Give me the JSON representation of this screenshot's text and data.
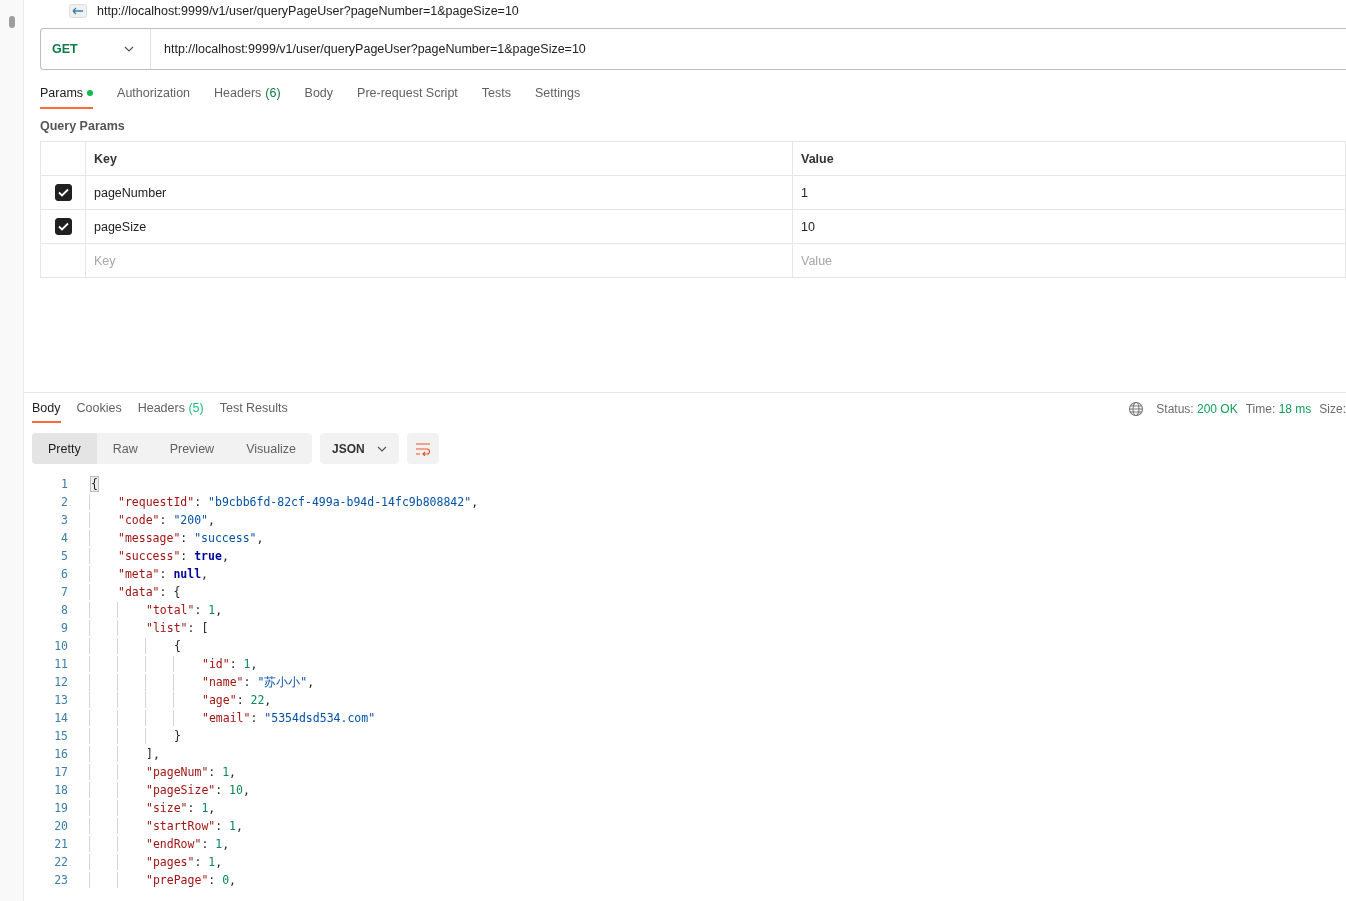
{
  "request_title": "http://localhost:9999/v1/user/queryPageUser?pageNumber=1&pageSize=10",
  "request_bar": {
    "method": "GET",
    "url": "http://localhost:9999/v1/user/queryPageUser?pageNumber=1&pageSize=10"
  },
  "request_tabs": [
    {
      "label": "Params",
      "dot": true,
      "selected": true
    },
    {
      "label": "Authorization",
      "dot": false,
      "selected": false
    },
    {
      "label": "Headers",
      "count": "(6)",
      "dot": false,
      "selected": false
    },
    {
      "label": "Body",
      "dot": false,
      "selected": false
    },
    {
      "label": "Pre-request Script",
      "dot": false,
      "selected": false
    },
    {
      "label": "Tests",
      "dot": false,
      "selected": false
    },
    {
      "label": "Settings",
      "dot": false,
      "selected": false
    }
  ],
  "query_params": {
    "title": "Query Params",
    "columns": [
      "Key",
      "Value"
    ],
    "rows": [
      {
        "checked": true,
        "key": "pageNumber",
        "value": "1"
      },
      {
        "checked": true,
        "key": "pageSize",
        "value": "10"
      }
    ],
    "new_row": {
      "key_placeholder": "Key",
      "value_placeholder": "Value"
    }
  },
  "response_tabs": [
    {
      "label": "Body",
      "selected": true
    },
    {
      "label": "Cookies",
      "selected": false
    },
    {
      "label": "Headers",
      "count": "(5)",
      "selected": false
    },
    {
      "label": "Test Results",
      "selected": false
    }
  ],
  "response_meta": {
    "status_label": "Status:",
    "status": "200 OK",
    "time_label": "Time:",
    "time": "18 ms",
    "size_label": "Size:"
  },
  "view_modes": [
    {
      "label": "Pretty",
      "selected": true
    },
    {
      "label": "Raw",
      "selected": false
    },
    {
      "label": "Preview",
      "selected": false
    },
    {
      "label": "Visualize",
      "selected": false
    }
  ],
  "format": "JSON",
  "code_lines": [
    {
      "number": "1",
      "tokens": [
        {
          "kind": "brace",
          "text": "{"
        }
      ],
      "children": [
        {
          "number": "2",
          "tokens": [
            {
              "kind": "key",
              "text": "\"requestId\""
            },
            {
              "kind": "punct",
              "text": ": "
            },
            {
              "kind": "str",
              "text": "\"b9cbb6fd-82cf-499a-b94d-14fc9b808842\""
            },
            {
              "kind": "punct",
              "text": ","
            }
          ]
        },
        {
          "number": "3",
          "tokens": [
            {
              "kind": "key",
              "text": "\"code\""
            },
            {
              "kind": "punct",
              "text": ": "
            },
            {
              "kind": "str",
              "text": "\"200\""
            },
            {
              "kind": "punct",
              "text": ","
            }
          ]
        },
        {
          "number": "4",
          "tokens": [
            {
              "kind": "key",
              "text": "\"message\""
            },
            {
              "kind": "punct",
              "text": ": "
            },
            {
              "kind": "str",
              "text": "\"success\""
            },
            {
              "kind": "punct",
              "text": ","
            }
          ]
        },
        {
          "number": "5",
          "tokens": [
            {
              "kind": "key",
              "text": "\"success\""
            },
            {
              "kind": "punct",
              "text": ": "
            },
            {
              "kind": "bool",
              "text": "true"
            },
            {
              "kind": "punct",
              "text": ","
            }
          ]
        },
        {
          "number": "6",
          "tokens": [
            {
              "kind": "key",
              "text": "\"meta\""
            },
            {
              "kind": "punct",
              "text": ": "
            },
            {
              "kind": "bool",
              "text": "null"
            },
            {
              "kind": "punct",
              "text": ","
            }
          ]
        },
        {
          "number": "7",
          "tokens": [
            {
              "kind": "key",
              "text": "\"data\""
            },
            {
              "kind": "punct",
              "text": ": {"
            }
          ],
          "children": [
            {
              "number": "8",
              "tokens": [
                {
                  "kind": "key",
                  "text": "\"total\""
                },
                {
                  "kind": "punct",
                  "text": ": "
                },
                {
                  "kind": "num",
                  "text": "1"
                },
                {
                  "kind": "punct",
                  "text": ","
                }
              ]
            },
            {
              "number": "9",
              "tokens": [
                {
                  "kind": "key",
                  "text": "\"list\""
                },
                {
                  "kind": "punct",
                  "text": ": ["
                }
              ],
              "children": [
                {
                  "number": "10",
                  "tokens": [
                    {
                      "kind": "punct",
                      "text": "{"
                    }
                  ],
                  "children": [
                    {
                      "number": "11",
                      "tokens": [
                        {
                          "kind": "key",
                          "text": "\"id\""
                        },
                        {
                          "kind": "punct",
                          "text": ": "
                        },
                        {
                          "kind": "num",
                          "text": "1"
                        },
                        {
                          "kind": "punct",
                          "text": ","
                        }
                      ]
                    },
                    {
                      "number": "12",
                      "tokens": [
                        {
                          "kind": "key",
                          "text": "\"name\""
                        },
                        {
                          "kind": "punct",
                          "text": ": "
                        },
                        {
                          "kind": "str",
                          "text": "\"苏小小\""
                        },
                        {
                          "kind": "punct",
                          "text": ","
                        }
                      ]
                    },
                    {
                      "number": "13",
                      "tokens": [
                        {
                          "kind": "key",
                          "text": "\"age\""
                        },
                        {
                          "kind": "punct",
                          "text": ": "
                        },
                        {
                          "kind": "num",
                          "text": "22"
                        },
                        {
                          "kind": "punct",
                          "text": ","
                        }
                      ]
                    },
                    {
                      "number": "14",
                      "tokens": [
                        {
                          "kind": "key",
                          "text": "\"email\""
                        },
                        {
                          "kind": "punct",
                          "text": ": "
                        },
                        {
                          "kind": "str",
                          "text": "\"5354dsd534.com\""
                        }
                      ]
                    }
                  ]
                },
                {
                  "number": "15",
                  "tokens": [
                    {
                      "kind": "punct",
                      "text": "}"
                    }
                  ]
                }
              ]
            },
            {
              "number": "16",
              "tokens": [
                {
                  "kind": "punct",
                  "text": "],"
                }
              ]
            },
            {
              "number": "17",
              "tokens": [
                {
                  "kind": "key",
                  "text": "\"pageNum\""
                },
                {
                  "kind": "punct",
                  "text": ": "
                },
                {
                  "kind": "num",
                  "text": "1"
                },
                {
                  "kind": "punct",
                  "text": ","
                }
              ]
            },
            {
              "number": "18",
              "tokens": [
                {
                  "kind": "key",
                  "text": "\"pageSize\""
                },
                {
                  "kind": "punct",
                  "text": ": "
                },
                {
                  "kind": "num",
                  "text": "10"
                },
                {
                  "kind": "punct",
                  "text": ","
                }
              ]
            },
            {
              "number": "19",
              "tokens": [
                {
                  "kind": "key",
                  "text": "\"size\""
                },
                {
                  "kind": "punct",
                  "text": ": "
                },
                {
                  "kind": "num",
                  "text": "1"
                },
                {
                  "kind": "punct",
                  "text": ","
                }
              ]
            },
            {
              "number": "20",
              "tokens": [
                {
                  "kind": "key",
                  "text": "\"startRow\""
                },
                {
                  "kind": "punct",
                  "text": ": "
                },
                {
                  "kind": "num",
                  "text": "1"
                },
                {
                  "kind": "punct",
                  "text": ","
                }
              ]
            },
            {
              "number": "21",
              "tokens": [
                {
                  "kind": "key",
                  "text": "\"endRow\""
                },
                {
                  "kind": "punct",
                  "text": ": "
                },
                {
                  "kind": "num",
                  "text": "1"
                },
                {
                  "kind": "punct",
                  "text": ","
                }
              ]
            },
            {
              "number": "22",
              "tokens": [
                {
                  "kind": "key",
                  "text": "\"pages\""
                },
                {
                  "kind": "punct",
                  "text": ": "
                },
                {
                  "kind": "num",
                  "text": "1"
                },
                {
                  "kind": "punct",
                  "text": ","
                }
              ]
            },
            {
              "number": "23",
              "tokens": [
                {
                  "kind": "key",
                  "text": "\"prePage\""
                },
                {
                  "kind": "punct",
                  "text": ": "
                },
                {
                  "kind": "num",
                  "text": "0"
                },
                {
                  "kind": "punct",
                  "text": ","
                }
              ]
            }
          ]
        }
      ]
    }
  ]
}
